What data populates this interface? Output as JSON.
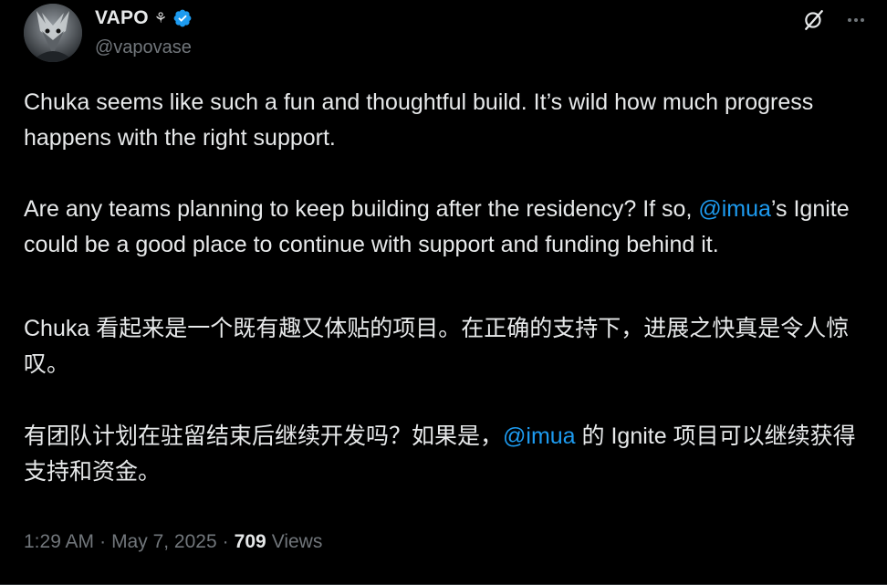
{
  "author": {
    "display_name": "VAPO",
    "badge_glyph": "⚘",
    "handle": "@vapovase",
    "verified_color": "#1d9bf0"
  },
  "icons": {
    "grok": "grok-icon",
    "more": "more-icon"
  },
  "tweet": {
    "p1": "Chuka seems like such a fun and thoughtful build. It’s wild how much progress happens with the right support.",
    "p2_before": "Are any teams planning to keep building after the residency? If so, ",
    "p2_mention": "@imua",
    "p2_after": "’s Ignite could be a good place to continue with support and funding behind it.",
    "p3": "Chuka 看起来是一个既有趣又体贴的项目。在正确的支持下，进展之快真是令人惊叹。",
    "p4_before": "有团队计划在驻留结束后继续开发吗？如果是，",
    "p4_mention": "@imua",
    "p4_after": " 的 Ignite 项目可以继续获得支持和资金。"
  },
  "meta": {
    "time": "1:29 AM",
    "sep1": "·",
    "date": "May 7, 2025",
    "sep2": "·",
    "views_count": "709",
    "views_label": "Views"
  },
  "colors": {
    "background": "#000000",
    "text": "#e7e9ea",
    "muted": "#71767b",
    "link": "#1d9bf0"
  }
}
